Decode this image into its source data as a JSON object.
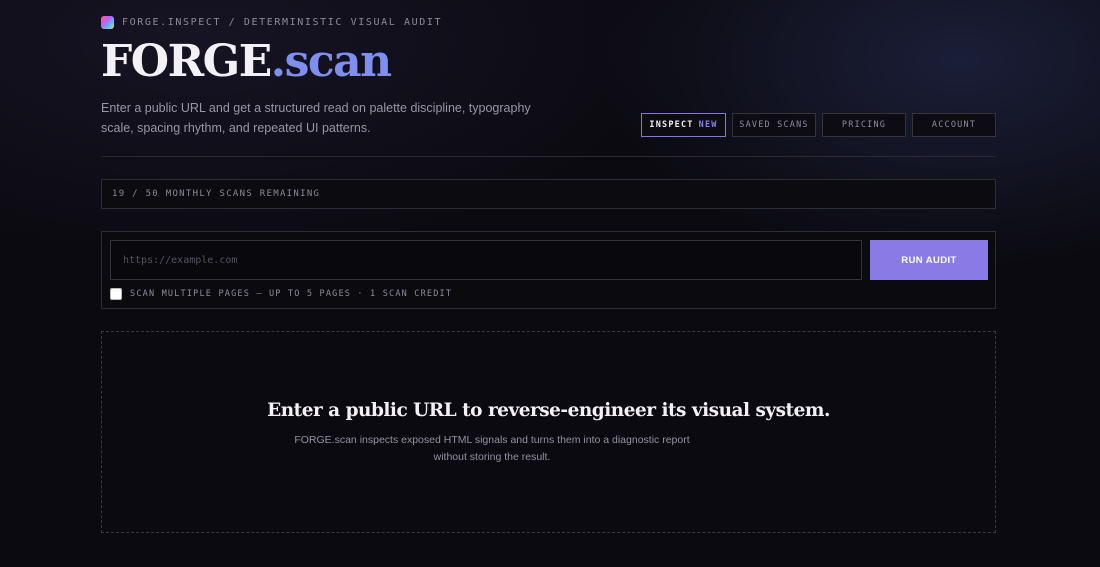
{
  "header": {
    "breadcrumb": "FORGE.INSPECT / DETERMINISTIC VISUAL AUDIT",
    "title_main": "FORGE",
    "title_accent": ".scan",
    "subtitle": "Enter a public URL and get a structured read on palette discipline, typography scale, spacing rhythm, and repeated UI patterns."
  },
  "nav": {
    "inspect_label": "INSPECT",
    "inspect_badge": "NEW",
    "saved_label": "SAVED SCANS",
    "pricing_label": "PRICING",
    "account_label": "ACCOUNT"
  },
  "quota": {
    "text": "19 / 50 MONTHLY SCANS REMAINING"
  },
  "form": {
    "url_placeholder": "https://example.com",
    "run_label": "RUN AUDIT",
    "multi_label": "SCAN MULTIPLE PAGES — UP TO 5 PAGES · 1 SCAN CREDIT"
  },
  "empty_state": {
    "heading": "Enter a public URL to reverse-engineer its visual system.",
    "description": "FORGE.scan inspects exposed HTML signals and turns them into a diagnostic report without storing the result."
  },
  "colors": {
    "accent": "#8a7ae6",
    "title_accent": "#7f8ff0",
    "background": "#0b0a10"
  }
}
